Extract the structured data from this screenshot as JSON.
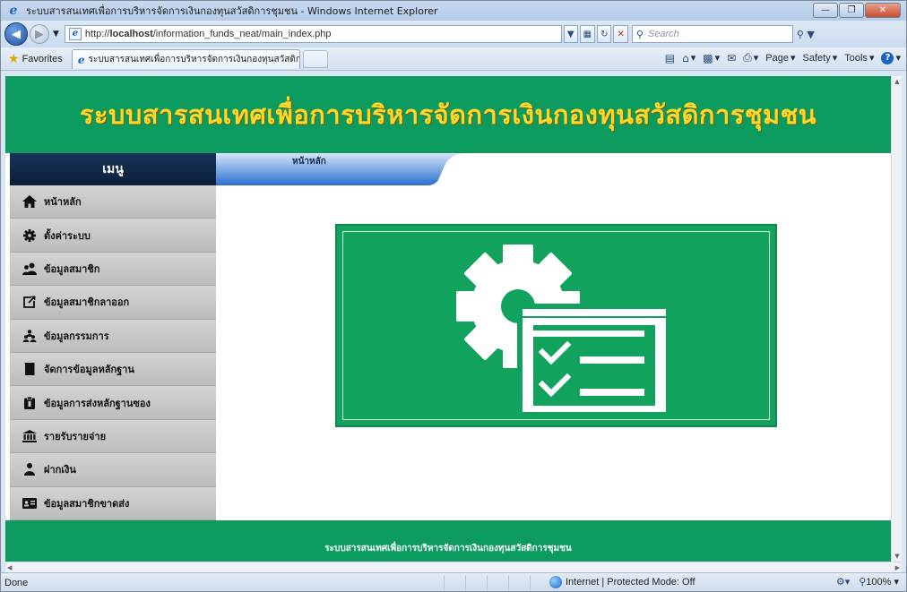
{
  "browser": {
    "window_title": "ระบบสารสนเทศเพื่อการบริหารจัดการเงินกองทุนสวัสดิการชุมชน - Windows Internet Explorer",
    "url": "http://localhost/information_funds_neat/main_index.php",
    "url_prefix": "http://",
    "url_host": "localhost",
    "url_path": "/information_funds_neat/main_index.php",
    "search_placeholder": "Search",
    "favorites_label": "Favorites",
    "tab_title": "ระบบสารสนเทศเพื่อการบริหารจัดการเงินกองทุนสวัสดิก...",
    "commands": [
      "Page",
      "Safety",
      "Tools"
    ],
    "status_text": "Done",
    "zone_text": "Internet | Protected Mode: Off",
    "zoom_level": "100%"
  },
  "site": {
    "header_title": "ระบบสารสนเทศเพื่อการบริหารจัดการเงินกองทุนสวัสดิการชุมชน",
    "menu_title": "เมนู",
    "breadcrumb": "หน้าหลัก",
    "footer_text": "ระบบสารสนเทศเพื่อการบริหารจัดการเงินกองทุนสวัสดิการชุมชน",
    "colors": {
      "brand_green": "#0b9b5e",
      "title_yellow": "#fbd92a",
      "menu_navy": "#0b1f3a",
      "tab_blue": "#1f5fb4"
    }
  },
  "sidebar": {
    "items": [
      {
        "label": "หน้าหลัก",
        "icon": "home-icon"
      },
      {
        "label": "ตั้งค่าระบบ",
        "icon": "gear-icon"
      },
      {
        "label": "ข้อมูลสมาชิก",
        "icon": "users-icon"
      },
      {
        "label": "ข้อมูลสมาชิกลาออก",
        "icon": "external-link-icon"
      },
      {
        "label": "ข้อมูลกรรมการ",
        "icon": "group-icon"
      },
      {
        "label": "จัดการข้อมูลหลักฐาน",
        "icon": "book-icon"
      },
      {
        "label": "ข้อมูลการส่งหลักฐานซอง",
        "icon": "clipboard-icon"
      },
      {
        "label": "รายรับรายจ่าย",
        "icon": "bank-icon"
      },
      {
        "label": "ฝากเงิน",
        "icon": "money-user-icon"
      },
      {
        "label": "ข้อมูลสมาชิกขาดส่ง",
        "icon": "id-card-icon"
      }
    ]
  },
  "main": {
    "hero_icon": "settings-checklist-icon"
  }
}
